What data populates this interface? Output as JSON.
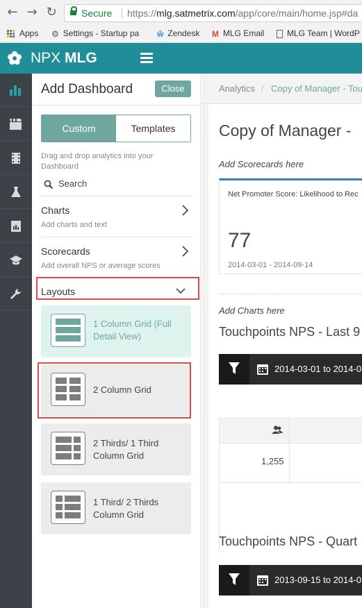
{
  "browser": {
    "secure_label": "Secure",
    "url_prefix": "https://",
    "url_host": "mlg.satmetrix.com",
    "url_path": "/app/core/main/home.jsp#da",
    "bookmarks": [
      {
        "label": "Apps",
        "icon": "apps-grid-icon"
      },
      {
        "label": "Settings - Startup pa",
        "icon": "gear-icon"
      },
      {
        "label": "Zendesk",
        "icon": "zendesk-icon"
      },
      {
        "label": "MLG Email",
        "icon": "gmail-icon"
      },
      {
        "label": "MLG Team | WordP",
        "icon": "page-icon"
      }
    ]
  },
  "app": {
    "logo_light": "NPX",
    "logo_bold": "MLG",
    "brand_color": "#1f8e99",
    "accent_color": "#6fa79f",
    "highlight_color": "#e0484c"
  },
  "rail": {
    "items": [
      {
        "icon": "bar-chart-icon",
        "active": true
      },
      {
        "icon": "film-icon",
        "active": false
      },
      {
        "icon": "film-strip-icon",
        "active": false
      },
      {
        "icon": "flask-icon",
        "active": false
      },
      {
        "icon": "report-icon",
        "active": false
      },
      {
        "icon": "graduation-cap-icon",
        "active": false
      },
      {
        "icon": "wrench-icon",
        "active": false
      }
    ]
  },
  "panel": {
    "title": "Add Dashboard",
    "close_label": "Close",
    "toggle": {
      "custom": "Custom",
      "templates": "Templates",
      "selected": "Custom"
    },
    "hint": "Drag and drop analytics into your Dashboard",
    "search_label": "Search",
    "sections": [
      {
        "title": "Charts",
        "subtitle": "Add charts and text"
      },
      {
        "title": "Scorecards",
        "subtitle": "Add overall NPS or average scores"
      }
    ],
    "layouts_title": "Layouts",
    "layouts": [
      {
        "label": "1 Column Grid (Full Detail View)"
      },
      {
        "label": "2 Column Grid"
      },
      {
        "label": "2 Thirds/ 1 Third Column Grid"
      },
      {
        "label": "1 Third/ 2 Thirds Column Grid"
      }
    ]
  },
  "main": {
    "breadcrumb": [
      "Analytics",
      "/",
      "Copy of Manager - Tou"
    ],
    "dashboard_title": "Copy of Manager -",
    "add_scorecards": "Add Scorecards here",
    "scorecard": {
      "title": "Net Promoter Score: Likelihood to Rec",
      "value": "77",
      "date_range": "2014-03-01 - 2014-09-14"
    },
    "add_charts": "Add Charts here",
    "chart1": {
      "title": "Touchpoints NPS - Last 9",
      "date_range": "2014-03-01 to 2014-0",
      "row_value": "1,255"
    },
    "chart2": {
      "title": "Touchpoints NPS - Quart",
      "date_range": "2013-09-15 to 2014-0"
    }
  }
}
